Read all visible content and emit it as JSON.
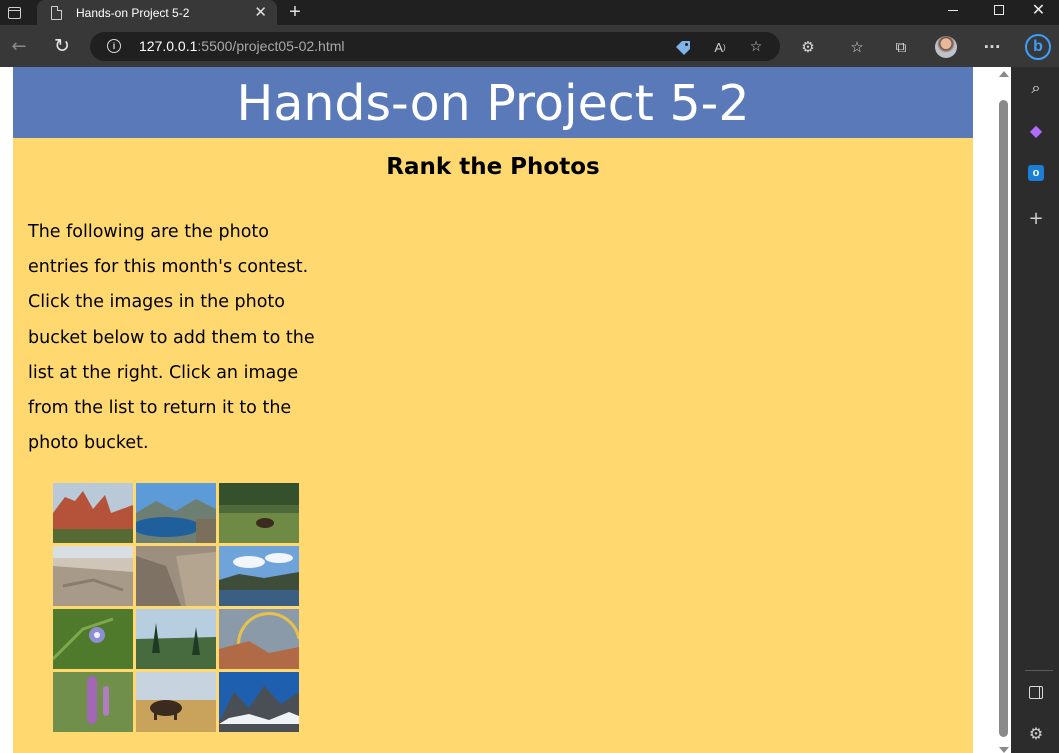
{
  "browser": {
    "tab_title": "Hands-on Project 5-2",
    "tab_close": "✕",
    "new_tab": "+",
    "url_host": "127.0.0.1",
    "url_rest": ":5500/project05-02.html",
    "window_close": "✕"
  },
  "page": {
    "banner_title": "Hands-on Project 5-2",
    "section_title": "Rank the Photos",
    "intro_text": "The following are the photo entries for this month's contest. Click the images in the photo bucket below to add them to the list at the right. Click an image from the list to return it to the photo bucket."
  },
  "photo_bucket": [
    {
      "name": "red-rock-formations-photo"
    },
    {
      "name": "mountain-lake-photo"
    },
    {
      "name": "moose-in-meadow-photo"
    },
    {
      "name": "rocky-canyon-photo"
    },
    {
      "name": "cliff-overlook-photo"
    },
    {
      "name": "alpine-lake-photo"
    },
    {
      "name": "purple-wildflower-photo"
    },
    {
      "name": "forest-valley-photo"
    },
    {
      "name": "rainbow-canyon-photo"
    },
    {
      "name": "lupine-flowers-photo"
    },
    {
      "name": "bison-on-prairie-photo"
    },
    {
      "name": "snowy-peaks-photo"
    }
  ]
}
